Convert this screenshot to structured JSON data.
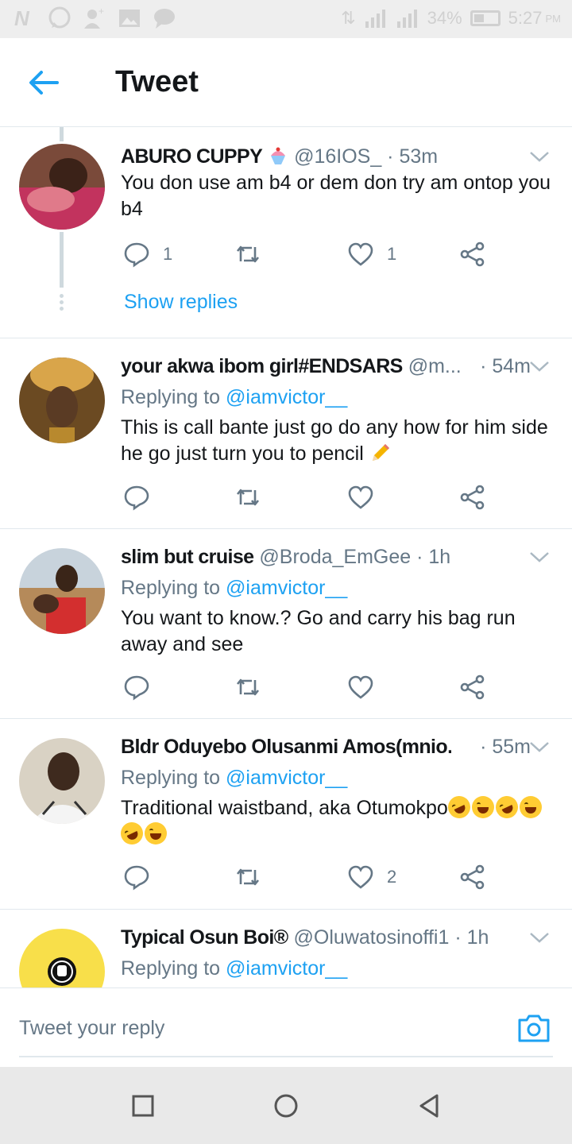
{
  "status_bar": {
    "battery": "34%",
    "time": "5:27",
    "ampm": "PM"
  },
  "header": {
    "title": "Tweet"
  },
  "tweets": [
    {
      "name": "ABURO CUPPY",
      "handle": "@16IOS_",
      "time": "· 53m",
      "text": "You don use am b4 or dem don try am ontop you b4",
      "reply_count": "1",
      "like_count": "1",
      "show_replies": "Show replies",
      "avatar_color": "#b03a5a"
    },
    {
      "name": "your akwa ibom girl#ENDSARS",
      "handle": "@m...",
      "time": "· 54m",
      "replying_prefix": "Replying to",
      "replying_to": "@iamvictor__",
      "text": "This is call bante just go do any how for him side he go just turn you to pencil",
      "avatar_color": "#8a5a2b"
    },
    {
      "name": "slim but cruise",
      "handle": "@Broda_EmGee",
      "time": "· 1h",
      "replying_prefix": "Replying to",
      "replying_to": "@iamvictor__",
      "text": "You want to know.? Go and carry his bag run away and see",
      "avatar_color": "#c9a27a"
    },
    {
      "name": "Bldr Oduyebo Olusanmi Amos(mnio...",
      "handle": "",
      "time": "· 55m",
      "replying_prefix": "Replying to",
      "replying_to": "@iamvictor__",
      "text": "Traditional waistband, aka Otumokpo",
      "like_count": "2",
      "avatar_color": "#d9dde0"
    },
    {
      "name": "Typical Osun Boi®",
      "handle": "@Oluwatosinoffi1",
      "time": "· 1h",
      "replying_prefix": "Replying to",
      "replying_to": "@iamvictor__",
      "avatar_color": "#f8df4a"
    }
  ],
  "reply_bar": {
    "placeholder": "Tweet your reply"
  },
  "colors": {
    "accent": "#1da1f2",
    "secondary_text": "#657786",
    "divider": "#e1e8ed"
  }
}
